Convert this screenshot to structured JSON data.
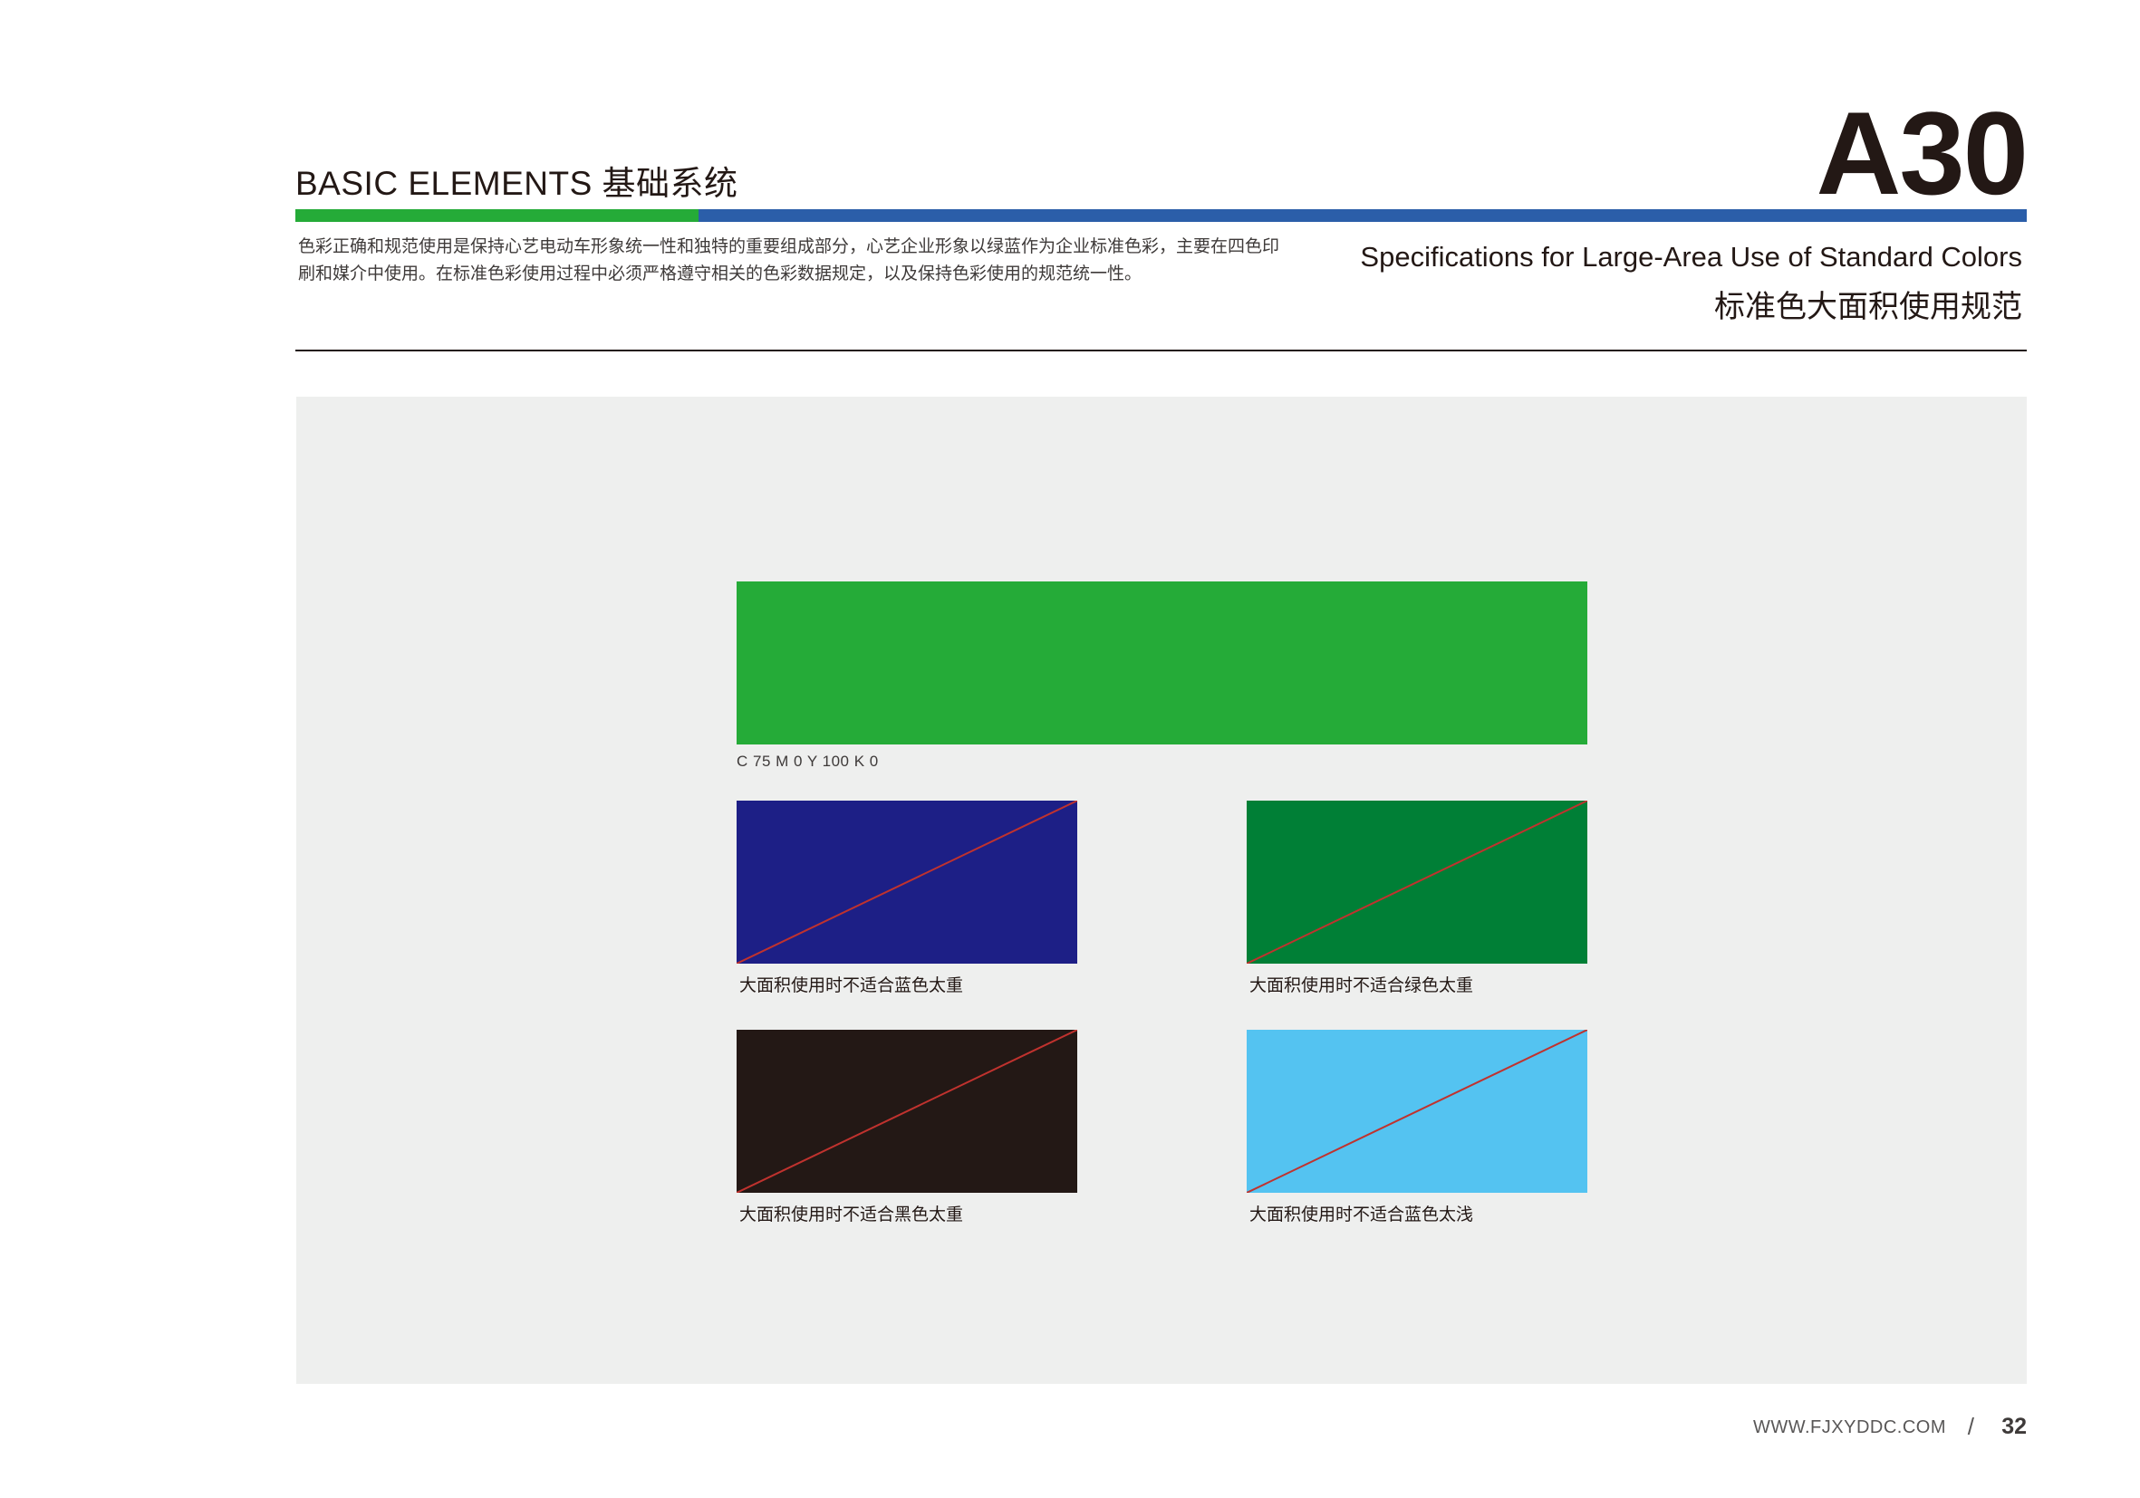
{
  "header": {
    "section_title": "BASIC ELEMENTS 基础系统",
    "page_code": "A30",
    "intro_lines": [
      "色彩正确和规范使用是保持心艺电动车形象统一性和独特的重要组成部分，心艺企业形象以绿蓝作为企业标准色彩，主要在四色印",
      "刷和媒介中使用。在标准色彩使用过程中必须严格遵守相关的色彩数据规定，以及保持色彩使用的规范统一性。"
    ],
    "title_en": "Specifications for Large-Area Use of Standard Colors",
    "title_cn": "标准色大面积使用规范"
  },
  "colors": {
    "brand_green": "#25ab38",
    "brand_blue": "#2b5ea9",
    "panel_bg": "#eeefee",
    "strike_line": "#c0322e"
  },
  "main_swatch": {
    "color": "#25ab38",
    "cmyk_label": "C 75 M 0 Y 100 K 0"
  },
  "incorrect_swatches": [
    {
      "color": "#1d1f86",
      "caption": "大面积使用时不适合蓝色太重"
    },
    {
      "color": "#007f36",
      "caption": "大面积使用时不适合绿色太重"
    },
    {
      "color": "#231815",
      "caption": "大面积使用时不适合黑色太重"
    },
    {
      "color": "#54c3f1",
      "caption": "大面积使用时不适合蓝色太浅"
    }
  ],
  "footer": {
    "url": "WWW.FJXYDDC.COM",
    "slash": "/",
    "page_number": "32"
  }
}
